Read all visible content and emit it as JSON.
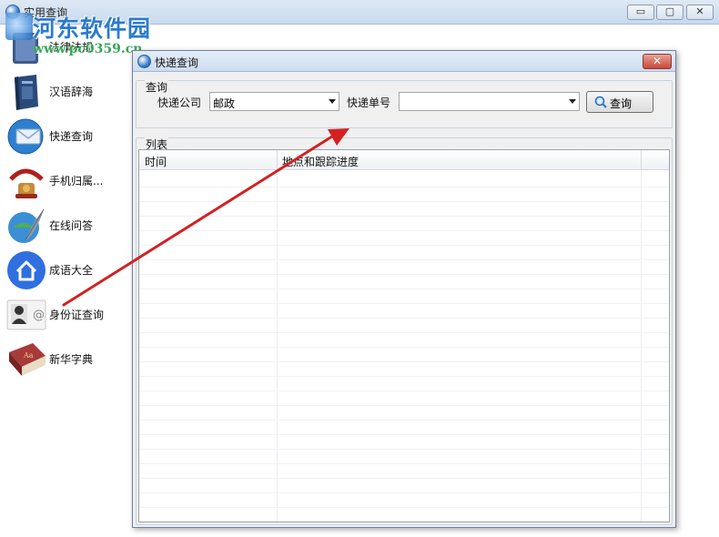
{
  "window": {
    "title": "实用查询",
    "controls": {
      "minimize": "▭",
      "maximize": "▢",
      "close": "✕"
    }
  },
  "watermark": {
    "title": "河东软件园",
    "url": "www.pc0359.cn"
  },
  "sidebar": {
    "items": [
      {
        "label": "法律法规",
        "icon": "law-book-icon"
      },
      {
        "label": "汉语辞海",
        "icon": "dictionary-book-icon"
      },
      {
        "label": "快递查询",
        "icon": "express-mail-icon"
      },
      {
        "label": "手机归属...",
        "icon": "phone-icon"
      },
      {
        "label": "在线问答",
        "icon": "feather-globe-icon"
      },
      {
        "label": "成语大全",
        "icon": "home-icon"
      },
      {
        "label": "身份证查询",
        "icon": "id-card-icon"
      },
      {
        "label": "新华字典",
        "icon": "xinhua-dictionary-icon"
      }
    ]
  },
  "dialog": {
    "title": "快递查询",
    "close": "✕",
    "query_group": {
      "label": "查询",
      "company_label": "快递公司",
      "company_value": "邮政",
      "tracking_label": "快递单号",
      "tracking_value": "",
      "query_button": "查询"
    },
    "list_group": {
      "label": "列表",
      "columns": [
        "时间",
        "地点和跟踪进度"
      ]
    }
  },
  "colors": {
    "annotation_arrow": "#d42020",
    "sidebar_selected_icon": "#2f6fe0"
  }
}
